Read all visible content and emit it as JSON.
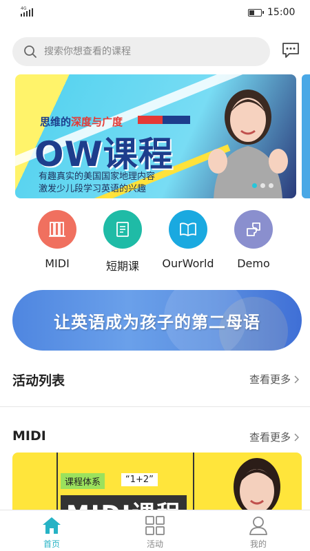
{
  "status_bar": {
    "network": "4G",
    "time": "15:00"
  },
  "search": {
    "placeholder": "搜索你想查看的课程"
  },
  "banner": {
    "subtitle_prefix": "思维的",
    "subtitle_highlight": "深度与广度",
    "headline": "OW课程",
    "desc_line1": "有趣真实的美国国家地理内容",
    "desc_line2": "激发少儿段学习英语的兴趣",
    "active_index": 0,
    "count": 3
  },
  "categories": [
    {
      "label": "MIDI",
      "color": "#f0705f",
      "icon": "books-icon"
    },
    {
      "label": "短期课",
      "color": "#1fbba6",
      "icon": "document-icon"
    },
    {
      "label": "OurWorld",
      "color": "#1aa9e0",
      "icon": "open-book-icon"
    },
    {
      "label": "Demo",
      "color": "#8a8fce",
      "icon": "puzzle-icon"
    }
  ],
  "slogan": {
    "text": "让英语成为孩子的第二母语"
  },
  "sections": {
    "activities": {
      "title": "活动列表",
      "more": "查看更多"
    },
    "midi": {
      "title": "MIDI",
      "more": "查看更多"
    }
  },
  "midi_card": {
    "tag1": "课程体系",
    "tag2": "“1+2”",
    "headline": "MIDI课程"
  },
  "tabbar": [
    {
      "label": "首页",
      "icon": "home-icon",
      "active": true
    },
    {
      "label": "活动",
      "icon": "grid-icon",
      "active": false
    },
    {
      "label": "我的",
      "icon": "user-icon",
      "active": false
    }
  ],
  "colors": {
    "accent": "#26b3c5",
    "brand_blue": "#1d3d8c"
  }
}
